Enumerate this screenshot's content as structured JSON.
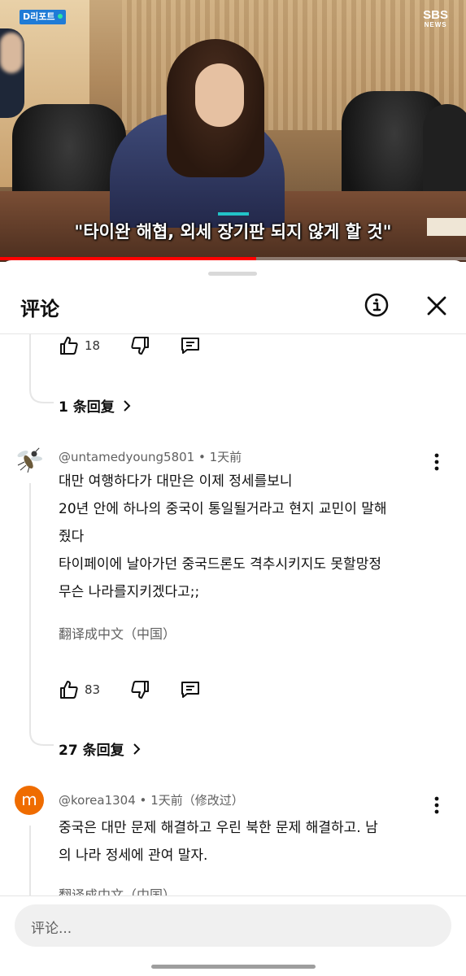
{
  "video": {
    "badge_label": "D리포트",
    "broadcaster": "SBS",
    "broadcaster_sub": "NEWS",
    "caption": "\"타이완 해협, 외세 장기판 되지 않게 할 것\"",
    "progress_fraction": 0.55,
    "progress_color": "#ff0000"
  },
  "comments_panel": {
    "title": "评论",
    "info_icon": "info-icon",
    "close_icon": "close-icon"
  },
  "top_comment_tail": {
    "likes": "18",
    "replies_label": "1 条回复"
  },
  "comments": [
    {
      "author": "@untamedyoung5801",
      "separator": "•",
      "time": "1天前",
      "lines": [
        "대만 여행하다가 대만은 이제  정세를보니",
        "20년 안에 하나의 중국이 통일될거라고 현지 교민이 말해",
        "줬다",
        "타이페이에 날아가던 중국드론도 격추시키지도 못할망정",
        "무슨 나라를지키겠다고;;"
      ],
      "translate_label": "翻译成中文（中国）",
      "likes": "83",
      "replies_label": "27 条回复"
    },
    {
      "author": "@korea1304",
      "separator": "•",
      "time": "1天前（修改过）",
      "avatar_letter": "m",
      "avatar_color": "#ef6c00",
      "lines": [
        "중국은 대만 문제 해결하고 우린 북한 문제 해결하고.  남",
        "의 나라 정세에 관여 말자."
      ],
      "translate_label": "翻译成中文（中国）"
    }
  ],
  "composer": {
    "placeholder": "评论..."
  }
}
